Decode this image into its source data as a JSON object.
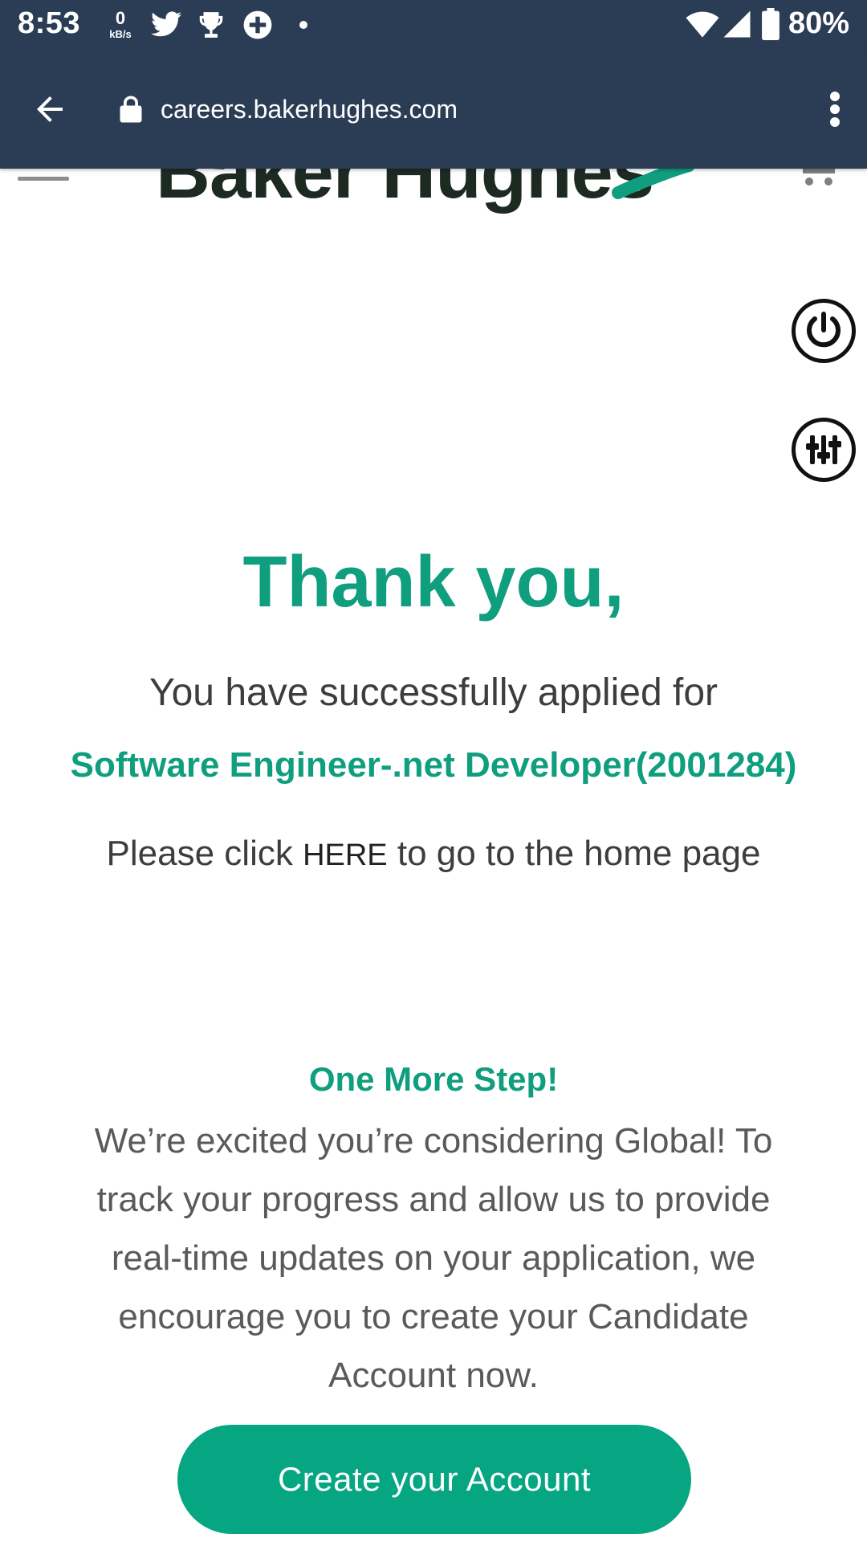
{
  "status_bar": {
    "time": "8:53",
    "net_speed_value": "0",
    "net_speed_unit": "kB/s",
    "notification_icons": [
      "twitter-icon",
      "trophy-icon",
      "plus-circle-icon",
      "dot-icon"
    ],
    "battery_percent": "80%"
  },
  "browser": {
    "url": "careers.bakerhughes.com"
  },
  "site_header": {
    "logo_text": "Baker Hughes"
  },
  "colors": {
    "header_bg": "#2b3c55",
    "brand_green": "#0f9e7e",
    "button_green": "#06a682"
  },
  "main": {
    "title": "Thank you,",
    "applied_text": "You have successfully applied for",
    "job_title": "Software Engineer-.net Developer(2001284)",
    "home_prefix": "Please click ",
    "home_link": "HERE",
    "home_suffix": " to go to the home page"
  },
  "next_step": {
    "title": "One More Step!",
    "body": "We’re excited you’re considering Global! To track your progress and allow us to provide real-time updates on your application, we encourage you to create your Candidate Account now.",
    "button_label": "Create your Account"
  }
}
